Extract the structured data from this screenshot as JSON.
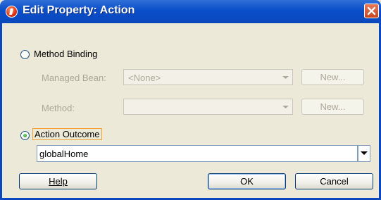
{
  "window": {
    "title": "Edit Property: Action"
  },
  "method_binding": {
    "label": "Method Binding",
    "selected": false,
    "managed_bean_label": "Managed Bean:",
    "managed_bean_value": "<None>",
    "method_label": "Method:",
    "method_value": "",
    "new_label": "New..."
  },
  "action_outcome": {
    "label": "Action Outcome",
    "selected": true,
    "value": "globalHome"
  },
  "buttons": {
    "help": "Help",
    "ok": "OK",
    "cancel": "Cancel"
  }
}
